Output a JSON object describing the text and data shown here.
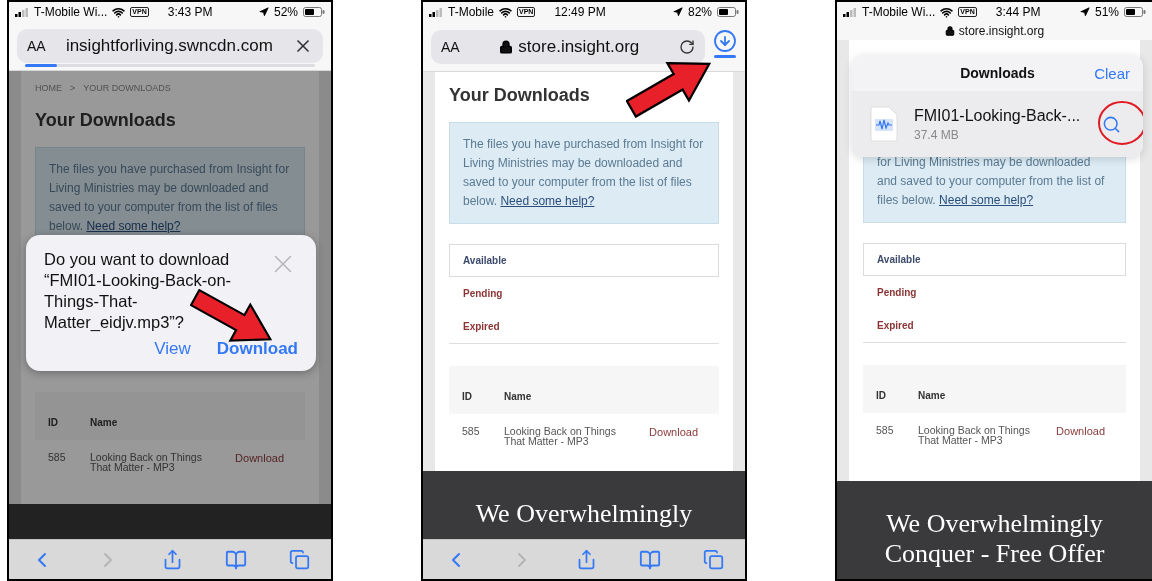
{
  "phones": [
    {
      "status_bar": {
        "carrier": "T-Mobile Wi...",
        "vpn": "VPN",
        "time": "3:43 PM",
        "battery": "52%"
      },
      "address_bar": {
        "kind": "full",
        "text_size": "AA",
        "url": "insightforliving.swncdn.com",
        "secure": false,
        "trailing_button": {
          "kind": "close"
        },
        "level": 0.11
      },
      "page": {
        "dimmed": true,
        "breadcrumb": {
          "items": [
            "HOME",
            "YOUR DOWNLOADS"
          ],
          "separator": ">"
        },
        "title": "Your Downloads",
        "info": {
          "text": "The files you have purchased from Insight for Living Ministries may be downloaded and saved to your computer from the list of files below.",
          "link": "Need some help?"
        },
        "table": {
          "columns": [
            "ID",
            "Name"
          ],
          "rows": [
            {
              "id": "585",
              "name": "Looking Back on Things That Matter - MP3",
              "action": "Download"
            }
          ]
        }
      },
      "dialog": {
        "message": "Do you want to download “FMI01-Looking-Back-on-Things-That-Matter_eidjv.mp3”?",
        "buttons": [
          {
            "label": "View",
            "primary": false,
            "highlighted": false
          },
          {
            "label": "Download",
            "primary": true,
            "highlighted": true
          }
        ]
      },
      "toolbar": {
        "back_enabled": true,
        "forward_enabled": false
      }
    },
    {
      "status_bar": {
        "carrier": "T-Mobile",
        "vpn": "VPN",
        "time": "12:49 PM",
        "battery": "82%"
      },
      "address_bar": {
        "kind": "full",
        "text_size": "AA",
        "url": "store.insight.org",
        "secure": true,
        "trailing_button": {
          "kind": "reload"
        },
        "downloads": {
          "highlighted": true
        }
      },
      "page": {
        "dimmed": false,
        "title": "Your Downloads",
        "info": {
          "text": "The files you have purchased from Insight for Living Ministries may be downloaded and saved to your computer from the list of files below.",
          "link": "Need some help?"
        },
        "filters": [
          {
            "label": "Available",
            "selected": true
          },
          {
            "label": "Pending",
            "selected": false
          },
          {
            "label": "Expired",
            "selected": false
          }
        ],
        "table": {
          "columns": [
            "ID",
            "Name"
          ],
          "rows": [
            {
              "id": "585",
              "name": "Looking Back on Things That Matter - MP3",
              "action": "Download"
            }
          ]
        }
      },
      "footer": {
        "lines": [
          "We Overwhelmingly"
        ]
      },
      "toolbar": {
        "back_enabled": true,
        "forward_enabled": false
      }
    },
    {
      "status_bar": {
        "carrier": "T-Mobile Wi...",
        "vpn": "VPN",
        "time": "3:44 PM",
        "battery": "51%"
      },
      "address_bar": {
        "kind": "compact",
        "url": "store.insight.org",
        "secure": true
      },
      "page": {
        "dimmed": false,
        "info": {
          "text": "for Living Ministries may be downloaded and saved to your computer from the list of files below.",
          "link": "Need some help?"
        },
        "filters": [
          {
            "label": "Available",
            "selected": true
          },
          {
            "label": "Pending",
            "selected": false
          },
          {
            "label": "Expired",
            "selected": false
          }
        ],
        "table": {
          "columns": [
            "ID",
            "Name"
          ],
          "rows": [
            {
              "id": "585",
              "name": "Looking Back on Things That Matter - MP3",
              "action": "Download"
            }
          ]
        }
      },
      "footer": {
        "lines": [
          "We Overwhelmingly",
          "Conquer - Free Offer"
        ]
      },
      "downloads_popover": {
        "title": "Downloads",
        "clear": "Clear",
        "items": [
          {
            "name": "FMI01-Looking-Back-...",
            "size": "37.4 MB",
            "highlighted": true
          }
        ]
      }
    }
  ]
}
